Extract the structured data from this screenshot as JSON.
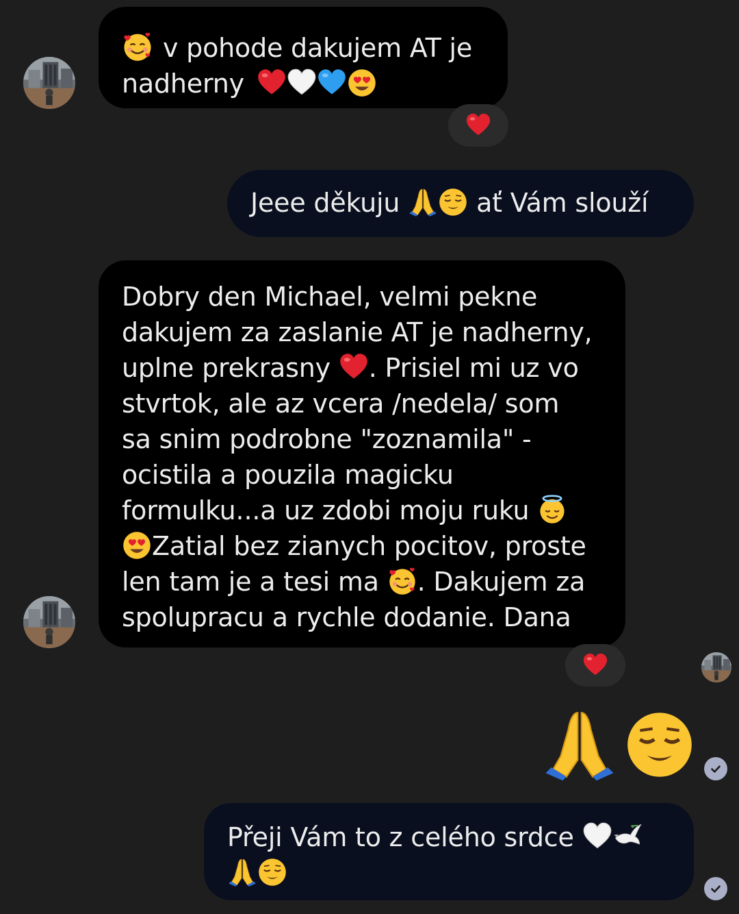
{
  "conversation": {
    "messages": [
      {
        "direction": "incoming",
        "lines": [
          "v pohode dakujem AT je",
          "nadherny"
        ],
        "reaction": "heart"
      },
      {
        "direction": "outgoing",
        "text_before": "Jeee děkuju",
        "text_after": "ať Vám slouží"
      },
      {
        "direction": "incoming",
        "lines": [
          "Dobry den Michael, velmi pekne",
          "dakujem za zaslanie AT je nadherny,",
          "uplne prekrasny",
          ". Prisiel mi  uz vo",
          "stvrtok, ale az vcera /nedela/ som",
          "sa snim podrobne \"zoznamila\" -",
          "ocistila a pouzila magicku",
          "formulku...a uz zdobi moju ruku",
          "Zatial bez zianych pocitov, proste",
          "len tam je a tesi ma",
          ". Dakujem za",
          "spolupracu a rychle dodanie. Dana"
        ],
        "reaction": "heart"
      },
      {
        "direction": "outgoing",
        "big_emoji": [
          "folded-hands",
          "relieved-face"
        ]
      },
      {
        "direction": "outgoing",
        "text": "Přeji Vám to z celého srdce"
      }
    ]
  },
  "colors": {
    "background": "#1e1e1e",
    "incoming_bubble": "#000000",
    "outgoing_bubble": "#0a0f1f",
    "reaction_pill": "#2b2b2b",
    "read_check": "#a9afc7"
  }
}
